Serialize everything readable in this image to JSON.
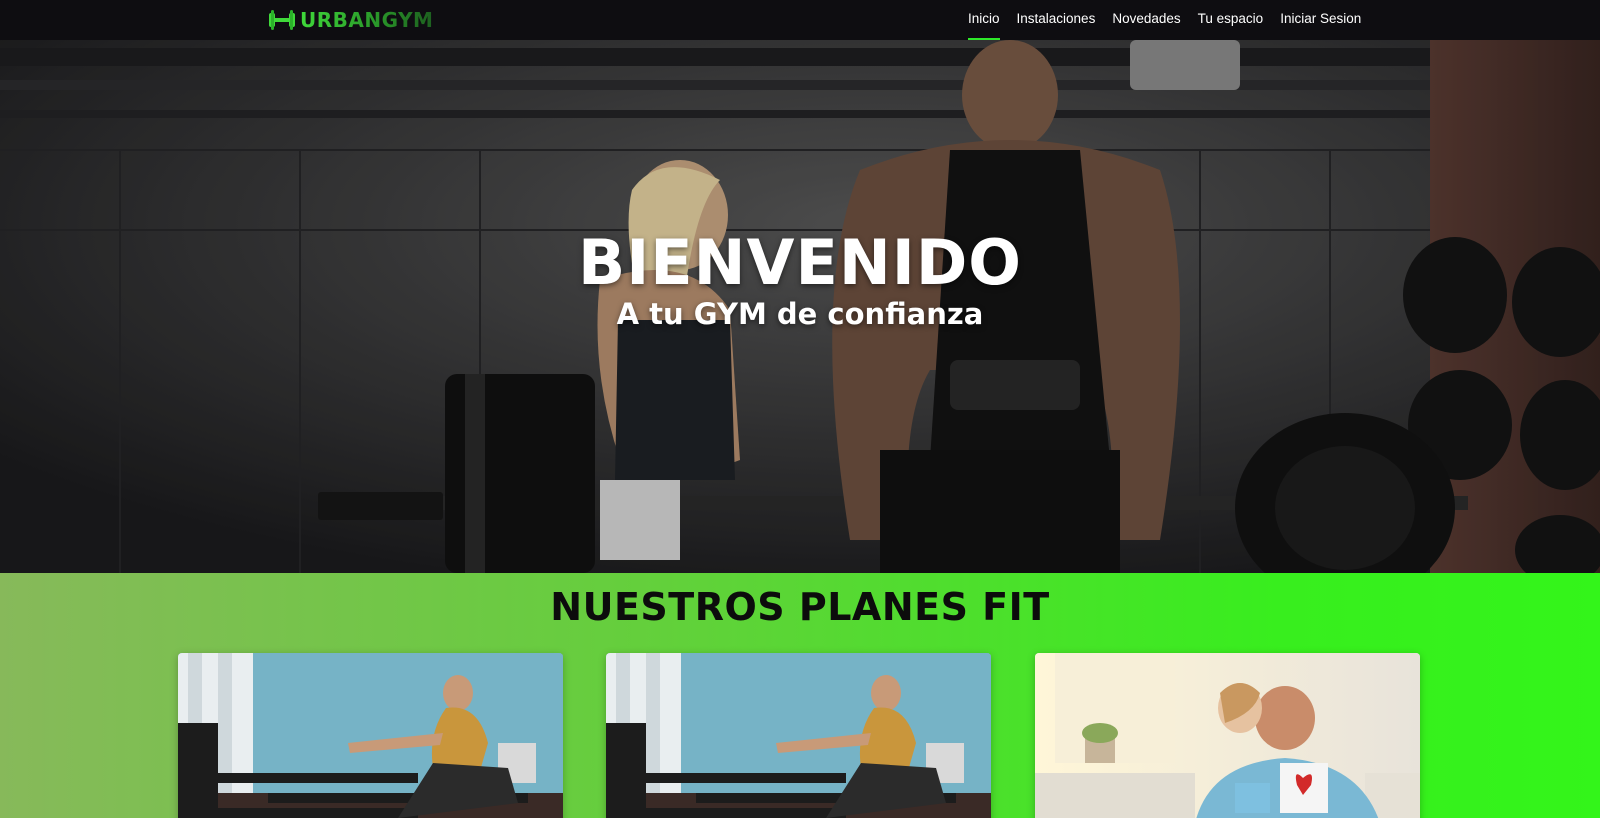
{
  "brand": {
    "name": "URBANGYM",
    "icon": "dumbbell-icon",
    "color": "#3fd83a"
  },
  "nav": {
    "items": [
      {
        "label": "Inicio",
        "active": true
      },
      {
        "label": "Instalaciones",
        "active": false
      },
      {
        "label": "Novedades",
        "active": false
      },
      {
        "label": "Tu espacio",
        "active": false
      },
      {
        "label": "Iniciar Sesion",
        "active": false
      }
    ],
    "active_color": "#2ee82a"
  },
  "hero": {
    "title": "BIENVENIDO",
    "subtitle": "A tu GYM de confianza"
  },
  "plans": {
    "title": "NUESTROS PLANES FIT",
    "background_colors": [
      "#87b95a",
      "#33f51a"
    ],
    "cards": [
      {
        "image": "rowing-machine-photo"
      },
      {
        "image": "rowing-machine-photo"
      },
      {
        "image": "father-daughter-gift-photo"
      }
    ]
  }
}
